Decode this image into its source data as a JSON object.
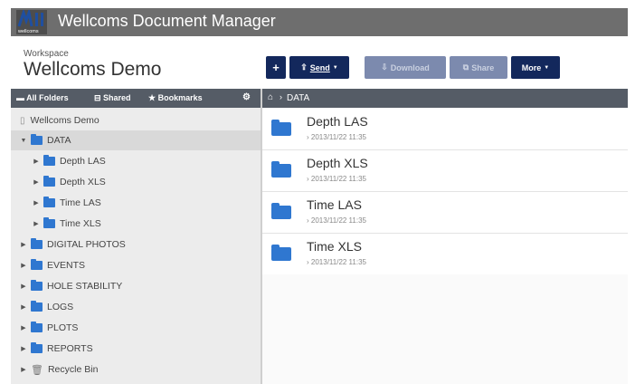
{
  "app": {
    "title": "Wellcoms Document Manager",
    "logo_text": "wellcoms"
  },
  "workspace": {
    "label": "Workspace",
    "name": "Wellcoms Demo"
  },
  "toolbar": {
    "add_label": "+",
    "send_label": "Send",
    "download_label": "Download",
    "share_label": "Share",
    "more_label": "More"
  },
  "sidebar": {
    "tabs": [
      "All Folders",
      "Shared",
      "Bookmarks"
    ],
    "root": "Wellcoms Demo",
    "items": [
      {
        "label": "DATA",
        "level": 1,
        "expanded": true
      },
      {
        "label": "Depth LAS",
        "level": 2
      },
      {
        "label": "Depth XLS",
        "level": 2
      },
      {
        "label": "Time LAS",
        "level": 2
      },
      {
        "label": "Time XLS",
        "level": 2
      },
      {
        "label": "DIGITAL PHOTOS",
        "level": 1
      },
      {
        "label": "EVENTS",
        "level": 1
      },
      {
        "label": "HOLE STABILITY",
        "level": 1
      },
      {
        "label": "LOGS",
        "level": 1
      },
      {
        "label": "PLOTS",
        "level": 1
      },
      {
        "label": "REPORTS",
        "level": 1
      }
    ],
    "recycle_bin": "Recycle Bin"
  },
  "breadcrumb": {
    "path": "DATA"
  },
  "files": [
    {
      "name": "Depth LAS",
      "date": "2013/11/22 11:35"
    },
    {
      "name": "Depth XLS",
      "date": "2013/11/22 11:35"
    },
    {
      "name": "Time LAS",
      "date": "2013/11/22 11:35"
    },
    {
      "name": "Time XLS",
      "date": "2013/11/22 11:35"
    }
  ],
  "colors": {
    "titlebar": "#6e6e6e",
    "button": "#13285c",
    "folder": "#2f77d0",
    "panel_header": "#555c66"
  }
}
